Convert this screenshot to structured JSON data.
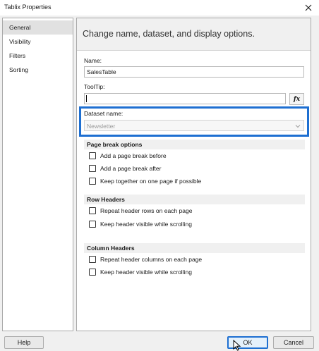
{
  "window": {
    "title": "Tablix Properties"
  },
  "sidebar": {
    "items": [
      {
        "label": "General",
        "selected": true
      },
      {
        "label": "Visibility",
        "selected": false
      },
      {
        "label": "Filters",
        "selected": false
      },
      {
        "label": "Sorting",
        "selected": false
      }
    ]
  },
  "main": {
    "header": "Change name, dataset, and display options.",
    "name_label": "Name:",
    "name_value": "SalesTable",
    "tooltip_label": "ToolTip:",
    "tooltip_value": "",
    "fx_label": "fx",
    "dataset_label": "Dataset name:",
    "dataset_value": "Newsletter",
    "page_break": {
      "title": "Page break options",
      "options": [
        {
          "label": "Add a page break before",
          "checked": false
        },
        {
          "label": "Add a page break after",
          "checked": false
        },
        {
          "label": "Keep together on one page if possible",
          "checked": false
        }
      ]
    },
    "row_headers": {
      "title": "Row Headers",
      "options": [
        {
          "label": "Repeat header rows on each page",
          "checked": false
        },
        {
          "label": "Keep header visible while scrolling",
          "checked": false
        }
      ]
    },
    "column_headers": {
      "title": "Column Headers",
      "options": [
        {
          "label": "Repeat header columns on each page",
          "checked": false
        },
        {
          "label": "Keep header visible while scrolling",
          "checked": false
        }
      ]
    }
  },
  "footer": {
    "help_label": "Help",
    "ok_label": "OK",
    "cancel_label": "Cancel"
  },
  "colors": {
    "accent": "#1e6fd1",
    "selected_nav": "#e1e1e1"
  }
}
